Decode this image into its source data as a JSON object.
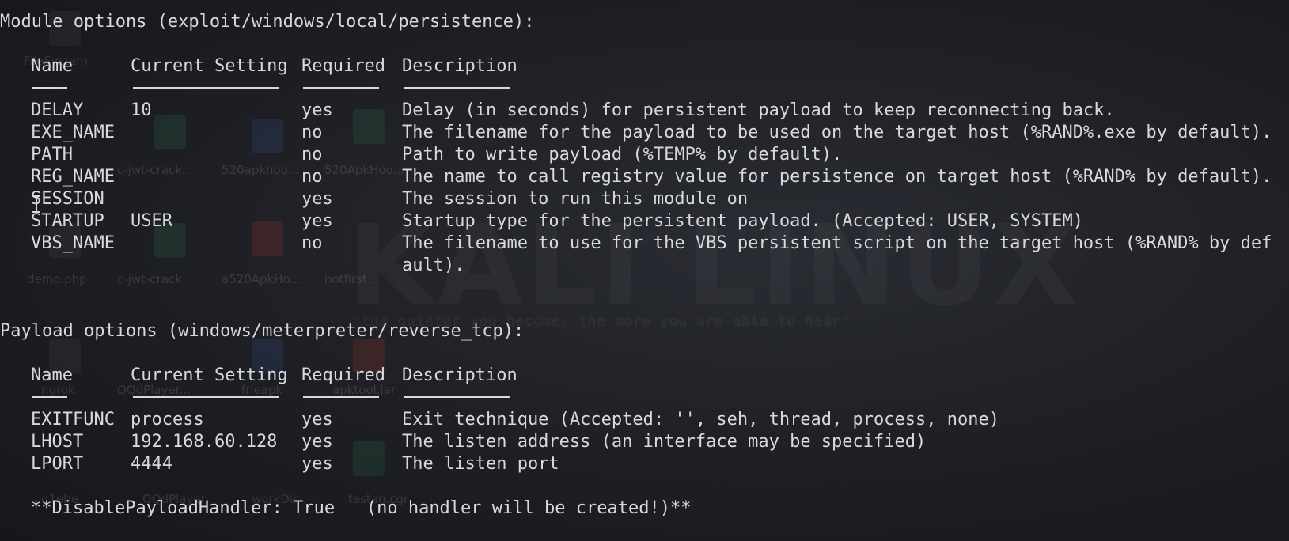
{
  "module_header": "Module options (exploit/windows/local/persistence):",
  "payload_header": "Payload options (windows/meterpreter/reverse_tcp):",
  "columns": {
    "name": "Name",
    "setting": "Current Setting",
    "required": "Required",
    "description": "Description"
  },
  "module_rows": [
    {
      "name": "DELAY",
      "setting": "10",
      "required": "yes",
      "description": "Delay (in seconds) for persistent payload to keep reconnecting back."
    },
    {
      "name": "EXE_NAME",
      "setting": "",
      "required": "no",
      "description": "The filename for the payload to be used on the target host (%RAND%.exe by default)."
    },
    {
      "name": "PATH",
      "setting": "",
      "required": "no",
      "description": "Path to write payload (%TEMP% by default)."
    },
    {
      "name": "REG_NAME",
      "setting": "",
      "required": "no",
      "description": "The name to call registry value for persistence on target host (%RAND% by default)."
    },
    {
      "name": "SESSION",
      "setting": "",
      "required": "yes",
      "description": "The session to run this module on"
    },
    {
      "name": "STARTUP",
      "setting": "USER",
      "required": "yes",
      "description": "Startup type for the persistent payload. (Accepted: USER, SYSTEM)"
    },
    {
      "name": "VBS_NAME",
      "setting": "",
      "required": "no",
      "description": "The filename to use for the VBS persistent script on the target host (%RAND% by def"
    }
  ],
  "module_wrap_line": "ault).",
  "payload_rows": [
    {
      "name": "EXITFUNC",
      "setting": "process",
      "required": "yes",
      "description": "Exit technique (Accepted: '', seh, thread, process, none)"
    },
    {
      "name": "LHOST",
      "setting": "192.168.60.128",
      "required": "yes",
      "description": "The listen address (an interface may be specified)"
    },
    {
      "name": "LPORT",
      "setting": "4444",
      "required": "yes",
      "description": "The listen port"
    }
  ],
  "footer_note": "**DisablePayloadHandler: True   (no handler will be created!)**",
  "background": {
    "watermark": "KALI LINUX",
    "tagline": "\"the quieter you become, the more you are able to hear\"",
    "desktop_labels": [
      "FileSystem",
      "c-jwt-crack...",
      "520apkhoo...",
      "520ApkHoo...",
      "demo.php",
      "c-jwt-crack...",
      "a520ApkHo...",
      "notfirst...",
      "ngrok",
      "QQdPlayer...",
      "frieapk",
      "apktool.jar",
      "d1ehe",
      "QQdPlayer",
      "workDir",
      "tastan.cgi"
    ]
  },
  "colors": {
    "background": "#1d1f24",
    "text": "#d7d9dd"
  }
}
